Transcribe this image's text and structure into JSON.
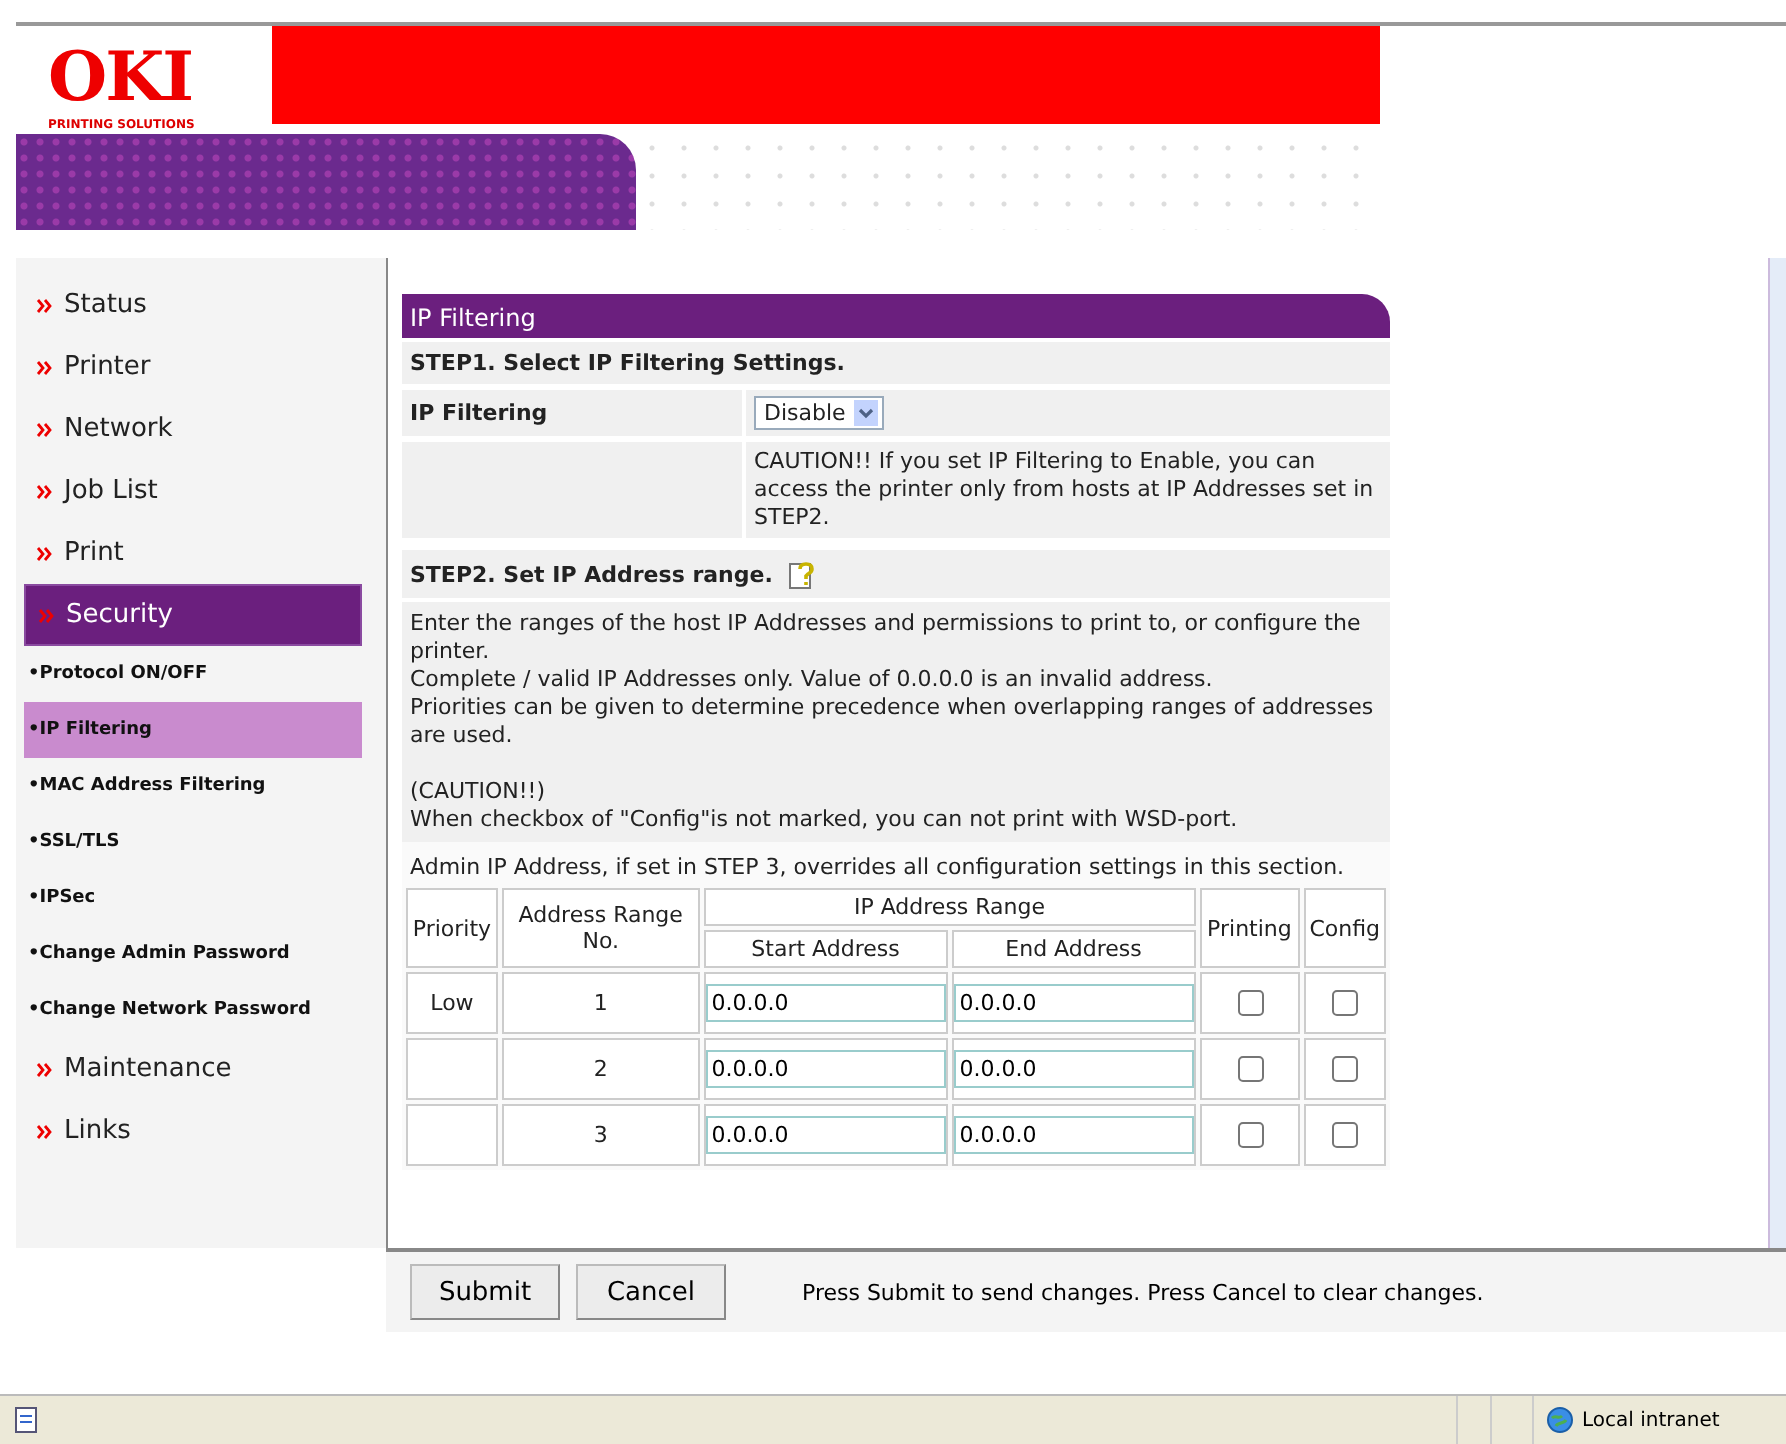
{
  "header": {
    "logo": "OKI",
    "tagline": "PRINTING SOLUTIONS"
  },
  "sidebar": {
    "items": [
      {
        "label": "Status",
        "kind": "main",
        "selected": false
      },
      {
        "label": "Printer",
        "kind": "main",
        "selected": false
      },
      {
        "label": "Network",
        "kind": "main",
        "selected": false
      },
      {
        "label": "Job List",
        "kind": "main",
        "selected": false
      },
      {
        "label": "Print",
        "kind": "main",
        "selected": false
      },
      {
        "label": "Security",
        "kind": "main",
        "selected": true
      },
      {
        "label": "•Protocol ON/OFF",
        "kind": "sub",
        "selected": false
      },
      {
        "label": "•IP Filtering",
        "kind": "sub",
        "selected": true
      },
      {
        "label": "•MAC Address Filtering",
        "kind": "sub",
        "selected": false
      },
      {
        "label": "•SSL/TLS",
        "kind": "sub",
        "selected": false
      },
      {
        "label": "•IPSec",
        "kind": "sub",
        "selected": false
      },
      {
        "label": "•Change Admin Password",
        "kind": "sub",
        "selected": false
      },
      {
        "label": "•Change Network Password",
        "kind": "sub",
        "selected": false
      },
      {
        "label": "Maintenance",
        "kind": "main",
        "selected": false
      },
      {
        "label": "Links",
        "kind": "main",
        "selected": false
      }
    ]
  },
  "panel": {
    "title": "IP Filtering",
    "step1": "STEP1.  Select IP Filtering Settings.",
    "setting": {
      "label": "IP Filtering",
      "value": "Disable"
    },
    "caution": "CAUTION!! If you set IP Filtering to Enable, you can access the printer only from hosts at IP Addresses set in STEP2.",
    "step2": "STEP2.  Set IP Address range.",
    "paragraphs": [
      "Enter the ranges of the host IP Addresses and permissions to print to, or configure the printer.",
      "Complete / valid IP Addresses only. Value of 0.0.0.0 is an invalid address.",
      "Priorities can be given to determine precedence when overlapping ranges of addresses are used."
    ],
    "caution_title": "(CAUTION!!)",
    "caution_text": "When checkbox of \"Config\"is not marked, you can not print with WSD-port.",
    "admin_note": "Admin IP Address, if set in STEP 3, overrides all configuration settings in this section."
  },
  "table": {
    "columns": {
      "priority": "Priority",
      "range_no": "Address Range No.",
      "range": "IP Address Range",
      "start": "Start Address",
      "end": "End Address",
      "printing": "Printing",
      "config": "Config"
    },
    "rows": [
      {
        "priority": "Low",
        "number": "1",
        "start": "0.0.0.0",
        "end": "0.0.0.0",
        "printing": false,
        "config": false
      },
      {
        "number": "2",
        "start": "0.0.0.0",
        "end": "0.0.0.0",
        "printing": false,
        "config": false
      },
      {
        "number": "3",
        "start": "0.0.0.0",
        "end": "0.0.0.0",
        "printing": false,
        "config": false
      }
    ]
  },
  "footer": {
    "buttons": [
      "Submit",
      "Cancel"
    ],
    "hint": "Press Submit to send changes. Press Cancel to clear changes."
  },
  "status_bar": {
    "zone": "Local intranet"
  }
}
